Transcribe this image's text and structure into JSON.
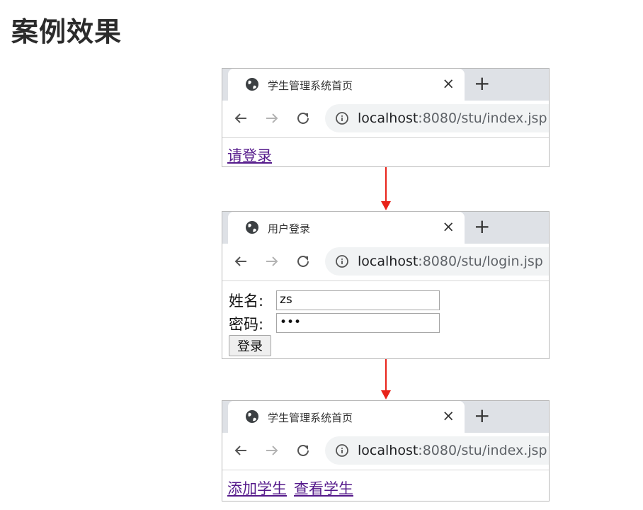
{
  "page": {
    "title": "案例效果"
  },
  "browsers": [
    {
      "tab_title": "学生管理系统首页",
      "close_glyph": "×",
      "new_tab_glyph": "+",
      "url_host": "localhost",
      "url_rest": ":8080/stu/index.jsp",
      "links": [
        "请登录"
      ]
    },
    {
      "tab_title": "用户登录",
      "close_glyph": "×",
      "new_tab_glyph": "+",
      "url_host": "localhost",
      "url_rest": ":8080/stu/login.jsp",
      "form": {
        "name_label": "姓名:",
        "name_value": "zs",
        "password_label": "密码:",
        "password_value": "•••",
        "submit_label": "登录"
      }
    },
    {
      "tab_title": "学生管理系统首页",
      "close_glyph": "×",
      "new_tab_glyph": "+",
      "url_host": "localhost",
      "url_rest": ":8080/stu/index.jsp",
      "links": [
        "添加学生",
        "查看学生"
      ]
    }
  ],
  "colors": {
    "arrow": "#e8231a",
    "link": "#551a8b",
    "tabbar_bg": "#dee1e6",
    "omnibox_bg": "#f1f3f4"
  },
  "icons": {
    "tab_favicon": "globe-icon",
    "back": "arrow-left-icon",
    "forward": "arrow-right-icon",
    "reload": "reload-icon",
    "site_info": "info-icon",
    "flow": "arrow-down-icon"
  }
}
